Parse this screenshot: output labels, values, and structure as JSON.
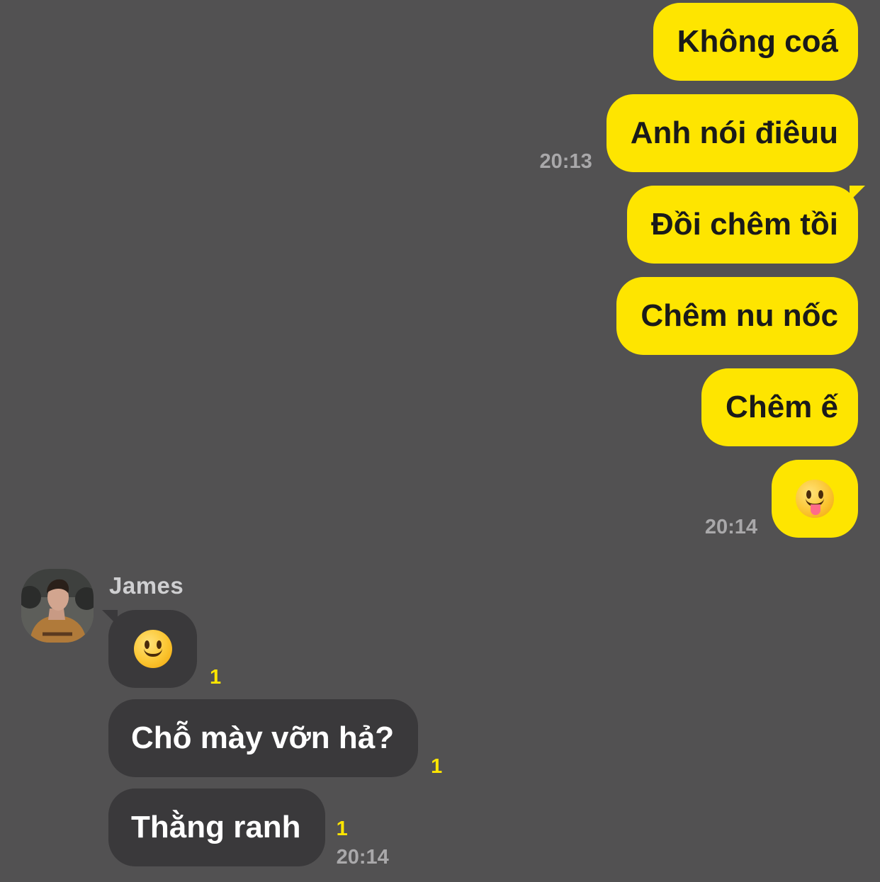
{
  "chat": {
    "outgoing": [
      {
        "text": "Không coá",
        "time": ""
      },
      {
        "text": "Anh nói điêuu",
        "time": "20:13"
      },
      {
        "text": "Đồi chêm tồi",
        "time": ""
      },
      {
        "text": "Chêm nu nốc",
        "time": ""
      },
      {
        "text": "Chêm ế",
        "time": ""
      },
      {
        "emoji": "face-with-tongue",
        "time": "20:14"
      }
    ],
    "incoming": {
      "sender": "James",
      "messages": [
        {
          "emoji": "slightly-smiling-face",
          "unread": "1",
          "time": ""
        },
        {
          "text": "Chỗ mày vỡn hả?",
          "unread": "1",
          "time": ""
        },
        {
          "text": "Thằng ranh",
          "unread": "1",
          "time": "20:14"
        }
      ]
    }
  },
  "colors": {
    "background": "#525152",
    "outgoing_bubble": "#FEE500",
    "incoming_bubble": "#3a393b",
    "unread_count": "#FEE500",
    "timestamp": "#a9a8aa"
  }
}
